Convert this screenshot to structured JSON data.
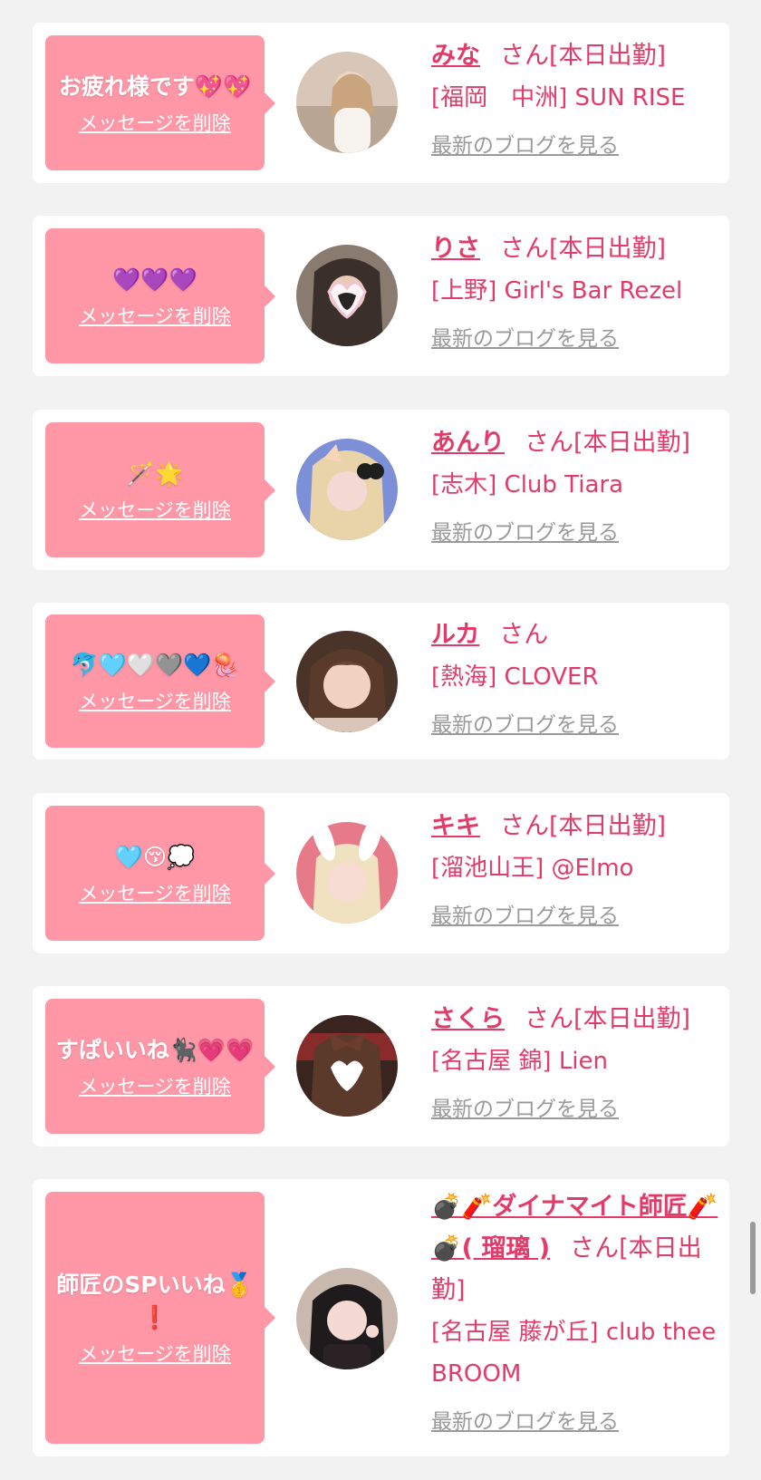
{
  "cards": [
    {
      "message": "お疲れ様です💖💖",
      "delete_label": "メッセージを削除",
      "name": "みな",
      "san": "さん[本日出勤]",
      "shop": "[福岡　中洲] SUN RISE",
      "blog": "最新のブログを見る"
    },
    {
      "message": "💜💜💜",
      "delete_label": "メッセージを削除",
      "name": "りさ",
      "san": "さん[本日出勤]",
      "shop": "[上野] Girl's Bar Rezel",
      "blog": "最新のブログを見る"
    },
    {
      "message": "🪄🌟",
      "delete_label": "メッセージを削除",
      "name": "あんり",
      "san": "さん[本日出勤]",
      "shop": "[志木] Club Tiara",
      "blog": "最新のブログを見る"
    },
    {
      "message": "🐬🩵🤍🩶💙🪼",
      "delete_label": "メッセージを削除",
      "name": "ルカ",
      "san": "さん",
      "shop": "[熱海] CLOVER",
      "blog": "最新のブログを見る"
    },
    {
      "message": "🩵😚💭",
      "delete_label": "メッセージを削除",
      "name": "キキ",
      "san": "さん[本日出勤]",
      "shop": "[溜池山王] @Elmo",
      "blog": "最新のブログを見る"
    },
    {
      "message": "すぱいいね🐈‍⬛💗💗",
      "delete_label": "メッセージを削除",
      "name": "さくら",
      "san": "さん[本日出勤]",
      "shop": "[名古屋 錦] Lien",
      "blog": "最新のブログを見る"
    },
    {
      "message": "師匠のSPいいね🥇❗️",
      "delete_label": "メッセージを削除",
      "name": "💣🧨ダイナマイト師匠🧨💣( 瑠璃 )",
      "san": "さん[本日出勤]",
      "shop": "[名古屋 藤が丘] club thee BROOM",
      "blog": "最新のブログを見る"
    }
  ],
  "colors": {
    "page_bg": "#f2f2f2",
    "card_bg": "#ffffff",
    "bubble_pink": "#ff97a7",
    "accent_pink": "#e23b69",
    "link_gray": "#9a9a9a"
  }
}
